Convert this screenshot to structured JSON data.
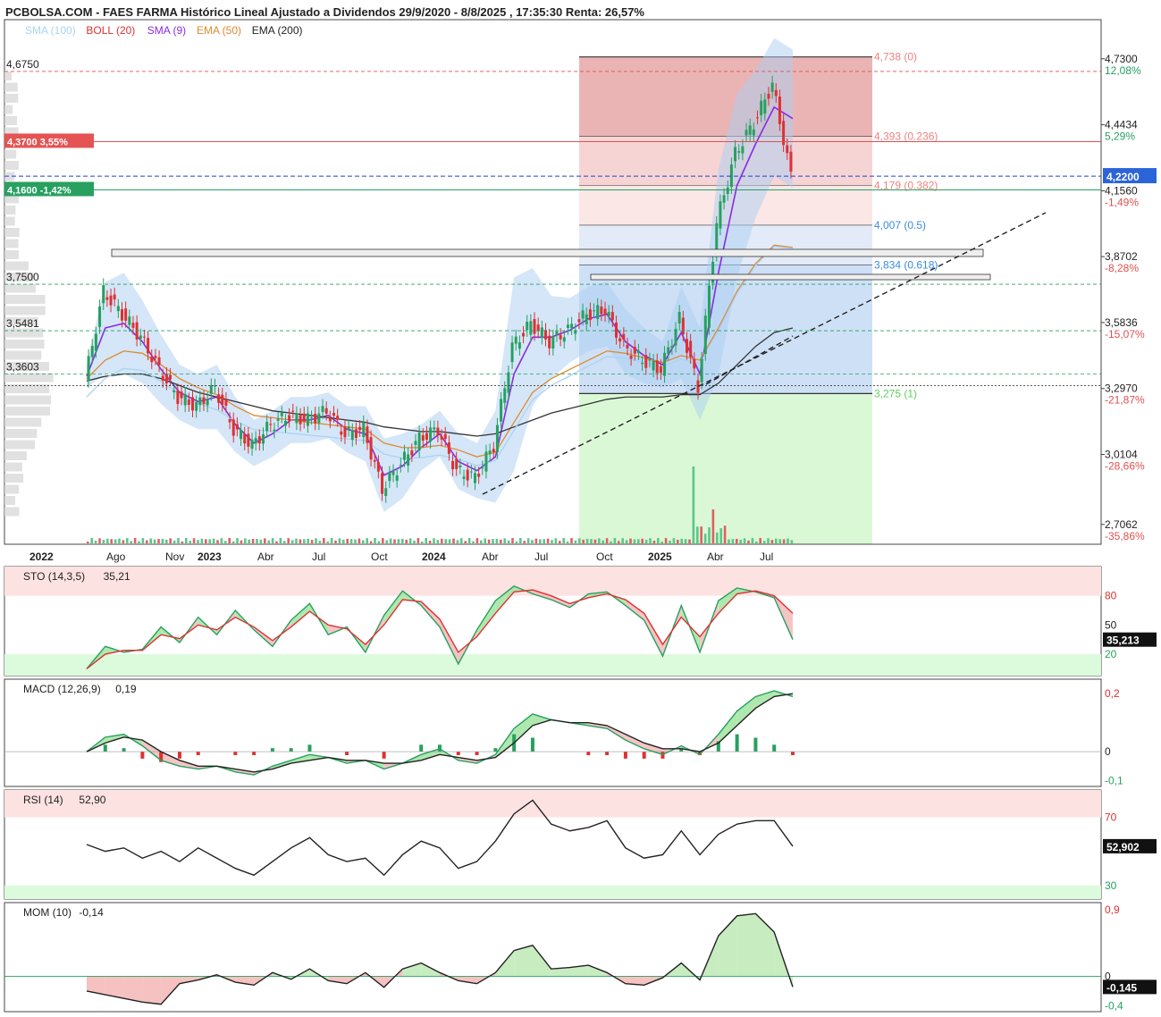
{
  "header": {
    "title": "PCBOLSA.COM - FAES FARMA Histórico Lineal Ajustado a Dividendos 29/9/2020 - 8/8/2025 , 17:35:30 Renta: 26,57%",
    "legend": [
      {
        "text": "SMA (100)",
        "color": "#a9d3f5"
      },
      {
        "text": "BOLL (20)",
        "color": "#e03030"
      },
      {
        "text": "SMA (9)",
        "color": "#8a2be2"
      },
      {
        "text": "EMA (50)",
        "color": "#e08a30"
      },
      {
        "text": "EMA (200)",
        "color": "#222222"
      }
    ]
  },
  "price_panel": {
    "left_labels": [
      "4,6750",
      "3,7500",
      "3,5481",
      "3,3603"
    ],
    "level_tags": [
      {
        "text": "4,3700  3,55%",
        "color": "#e55353"
      },
      {
        "text": "4,1600  -1,42%",
        "color": "#27a060"
      }
    ],
    "right_axis": [
      "4,7300",
      "12,08%",
      "4,4434",
      "5,29%",
      "4,1560",
      "-1,49%",
      "3,8702",
      "-8,28%",
      "3,5836",
      "-15,07%",
      "3,2970",
      "-21,87%",
      "3,0104",
      "-28,66%",
      "2,7062",
      "-35,86%"
    ],
    "current_price": "4,2200",
    "fib_levels": [
      "4,738 (0)",
      "4,393 (0.236)",
      "4,179 (0.382)",
      "4,007 (0.5)",
      "3,834 (0.618)",
      "3,275 (1)"
    ]
  },
  "x_axis": [
    "2022",
    "Ago",
    "Nov",
    "2023",
    "Abr",
    "Jul",
    "Oct",
    "2024",
    "Abr",
    "Jul",
    "Oct",
    "2025",
    "Abr",
    "Jul"
  ],
  "indicators": {
    "sto": {
      "label": "STO (14,3,5)",
      "value": "35,21",
      "ticks": [
        "80",
        "50",
        "20"
      ],
      "current": "35,213"
    },
    "macd": {
      "label": "MACD (12,26,9)",
      "value": "0,19",
      "ticks": [
        "0,2",
        "0",
        "-0,1"
      ]
    },
    "rsi": {
      "label": "RSI (14)",
      "value": "52,90",
      "ticks": [
        "70",
        "30"
      ],
      "current": "52,902"
    },
    "mom": {
      "label": "MOM (10)",
      "value": "-0,14",
      "ticks": [
        "0,9",
        "0",
        "-0,4"
      ],
      "current": "-0,145"
    }
  },
  "chart_data": [
    {
      "type": "line",
      "title": "PCBOLSA.COM - FAES FARMA Histórico Lineal Ajustado a Dividendos 29/9/2020 - 8/8/2025 , 17:35:30 Renta: 26,57%",
      "x": [
        "2022-06",
        "2022-07",
        "2022-08",
        "2022-09",
        "2022-10",
        "2022-11",
        "2022-12",
        "2023-01",
        "2023-02",
        "2023-03",
        "2023-04",
        "2023-05",
        "2023-06",
        "2023-07",
        "2023-08",
        "2023-09",
        "2023-10",
        "2023-11",
        "2023-12",
        "2024-01",
        "2024-02",
        "2024-03",
        "2024-04",
        "2024-05",
        "2024-06",
        "2024-07",
        "2024-08",
        "2024-09",
        "2024-10",
        "2024-11",
        "2024-12",
        "2025-01",
        "2025-02",
        "2025-03",
        "2025-04",
        "2025-05",
        "2025-06",
        "2025-07",
        "2025-08"
      ],
      "series": [
        {
          "name": "Close",
          "values": [
            3.33,
            3.72,
            3.62,
            3.52,
            3.38,
            3.26,
            3.22,
            3.3,
            3.12,
            3.05,
            3.14,
            3.18,
            3.16,
            3.2,
            3.1,
            3.12,
            2.86,
            2.97,
            3.08,
            3.12,
            2.94,
            2.91,
            3.05,
            3.48,
            3.58,
            3.5,
            3.55,
            3.62,
            3.64,
            3.48,
            3.42,
            3.38,
            3.6,
            3.3,
            4.02,
            4.32,
            4.45,
            4.62,
            4.22
          ]
        },
        {
          "name": "SMA (9)",
          "values": [
            3.35,
            3.56,
            3.58,
            3.5,
            3.38,
            3.28,
            3.24,
            3.26,
            3.14,
            3.06,
            3.1,
            3.16,
            3.16,
            3.18,
            3.12,
            3.1,
            2.92,
            2.96,
            3.04,
            3.1,
            2.98,
            2.94,
            3.0,
            3.36,
            3.52,
            3.52,
            3.55,
            3.6,
            3.62,
            3.5,
            3.44,
            3.4,
            3.54,
            3.36,
            3.8,
            4.18,
            4.36,
            4.52,
            4.47
          ]
        },
        {
          "name": "EMA (50)",
          "values": [
            3.34,
            3.42,
            3.46,
            3.45,
            3.4,
            3.34,
            3.3,
            3.27,
            3.22,
            3.18,
            3.17,
            3.16,
            3.15,
            3.14,
            3.13,
            3.12,
            3.06,
            3.04,
            3.04,
            3.05,
            3.03,
            3.0,
            3.02,
            3.15,
            3.28,
            3.34,
            3.38,
            3.42,
            3.46,
            3.45,
            3.43,
            3.41,
            3.44,
            3.42,
            3.56,
            3.72,
            3.84,
            3.92,
            3.91
          ]
        },
        {
          "name": "EMA (200)",
          "values": [
            3.33,
            3.35,
            3.36,
            3.36,
            3.34,
            3.31,
            3.28,
            3.26,
            3.24,
            3.22,
            3.2,
            3.19,
            3.18,
            3.17,
            3.16,
            3.15,
            3.13,
            3.12,
            3.11,
            3.11,
            3.1,
            3.09,
            3.1,
            3.13,
            3.16,
            3.19,
            3.21,
            3.23,
            3.25,
            3.26,
            3.26,
            3.26,
            3.27,
            3.27,
            3.32,
            3.4,
            3.48,
            3.54,
            3.56
          ]
        }
      ],
      "fib_levels": [
        4.738,
        4.393,
        4.179,
        4.007,
        3.834,
        3.275
      ],
      "ylim": [
        2.62,
        4.9
      ],
      "xlabel": "",
      "ylabel": ""
    },
    {
      "type": "line",
      "title": "STO (14,3,5)",
      "series": [
        {
          "name": "%K",
          "values": [
            5,
            28,
            22,
            25,
            48,
            32,
            58,
            40,
            65,
            45,
            28,
            55,
            72,
            40,
            48,
            22,
            60,
            85,
            70,
            48,
            10,
            45,
            75,
            90,
            82,
            76,
            68,
            82,
            84,
            70,
            55,
            18,
            70,
            22,
            75,
            88,
            84,
            78,
            35
          ]
        },
        {
          "name": "%D",
          "values": [
            5,
            20,
            24,
            24,
            40,
            36,
            50,
            45,
            58,
            48,
            34,
            48,
            64,
            50,
            46,
            30,
            50,
            76,
            74,
            56,
            22,
            38,
            62,
            84,
            86,
            80,
            72,
            78,
            82,
            76,
            62,
            30,
            58,
            38,
            62,
            82,
            85,
            80,
            62
          ]
        }
      ],
      "ylim": [
        0,
        100
      ]
    },
    {
      "type": "line",
      "title": "MACD (12,26,9)",
      "series": [
        {
          "name": "MACD",
          "values": [
            0.0,
            0.05,
            0.06,
            0.02,
            -0.03,
            -0.05,
            -0.06,
            -0.05,
            -0.07,
            -0.08,
            -0.05,
            -0.03,
            -0.01,
            -0.02,
            -0.04,
            -0.03,
            -0.06,
            -0.04,
            -0.01,
            0.01,
            -0.03,
            -0.04,
            -0.01,
            0.08,
            0.13,
            0.11,
            0.1,
            0.09,
            0.08,
            0.04,
            0.01,
            -0.01,
            0.02,
            -0.01,
            0.06,
            0.14,
            0.19,
            0.21,
            0.19
          ]
        },
        {
          "name": "Signal",
          "values": [
            0.0,
            0.03,
            0.05,
            0.04,
            0.0,
            -0.03,
            -0.05,
            -0.05,
            -0.06,
            -0.07,
            -0.06,
            -0.04,
            -0.03,
            -0.02,
            -0.03,
            -0.03,
            -0.04,
            -0.04,
            -0.03,
            -0.01,
            -0.02,
            -0.03,
            -0.02,
            0.03,
            0.09,
            0.11,
            0.1,
            0.1,
            0.09,
            0.06,
            0.03,
            0.01,
            0.01,
            0.0,
            0.03,
            0.09,
            0.15,
            0.19,
            0.2
          ]
        }
      ],
      "ylim": [
        -0.12,
        0.25
      ]
    },
    {
      "type": "line",
      "title": "RSI (14)",
      "series": [
        {
          "name": "RSI",
          "values": [
            54,
            50,
            52,
            46,
            50,
            44,
            52,
            46,
            40,
            36,
            44,
            52,
            58,
            48,
            44,
            46,
            36,
            48,
            56,
            52,
            40,
            44,
            56,
            72,
            80,
            66,
            62,
            64,
            68,
            52,
            46,
            48,
            62,
            48,
            60,
            66,
            68,
            68,
            53
          ]
        }
      ],
      "ylim": [
        20,
        85
      ]
    },
    {
      "type": "area",
      "title": "MOM (10)",
      "series": [
        {
          "name": "MOM",
          "values": [
            -0.2,
            -0.25,
            -0.3,
            -0.35,
            -0.38,
            -0.1,
            -0.05,
            0.02,
            -0.08,
            -0.12,
            0.05,
            -0.04,
            0.1,
            -0.06,
            -0.1,
            0.05,
            -0.15,
            0.1,
            0.18,
            0.05,
            -0.06,
            -0.1,
            0.05,
            0.35,
            0.42,
            0.1,
            0.12,
            0.15,
            0.05,
            -0.1,
            -0.12,
            -0.02,
            0.18,
            -0.05,
            0.55,
            0.82,
            0.85,
            0.6,
            -0.145
          ]
        }
      ],
      "ylim": [
        -0.45,
        1.0
      ]
    }
  ]
}
